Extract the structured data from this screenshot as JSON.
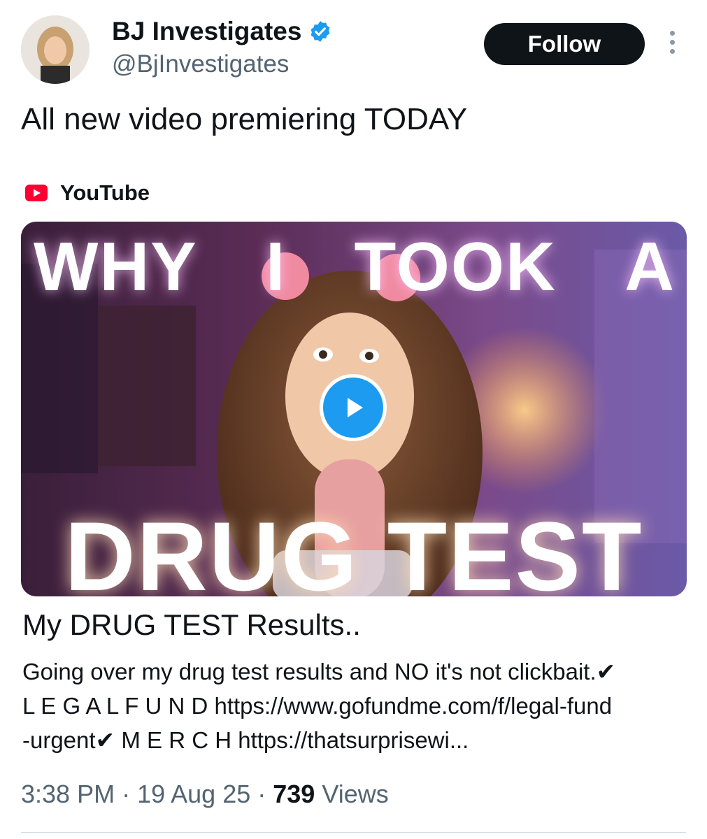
{
  "author": {
    "display_name": "BJ Investigates",
    "handle": "@BjInvestigates",
    "verified": true
  },
  "header": {
    "follow_label": "Follow"
  },
  "tweet": {
    "text": "All new video premiering TODAY"
  },
  "card": {
    "source": "YouTube",
    "thumbnail_text_top": [
      "WHY",
      "I",
      "TOOK",
      "A"
    ],
    "thumbnail_text_bottom": "DRUG TEST",
    "title": "My DRUG TEST Results..",
    "description_lines": [
      "Going over my drug test results and NO it's not clickbait.✔",
      "L E G A L F U N D https://www.gofundme.com/f/legal-fund",
      "-urgent✔ M E R C H https://thatsurprisewi..."
    ]
  },
  "meta": {
    "time": "3:38 PM",
    "separator": " · ",
    "date": "19 Aug 25",
    "views_count": "739",
    "views_label": "Views"
  },
  "colors": {
    "verified_blue": "#1d9bf0",
    "follow_bg": "#0f1419",
    "youtube_red": "#ff0033",
    "muted_text": "#536471"
  },
  "icons": [
    "avatar",
    "verified-badge-icon",
    "more-icon",
    "youtube-icon",
    "play-icon"
  ]
}
